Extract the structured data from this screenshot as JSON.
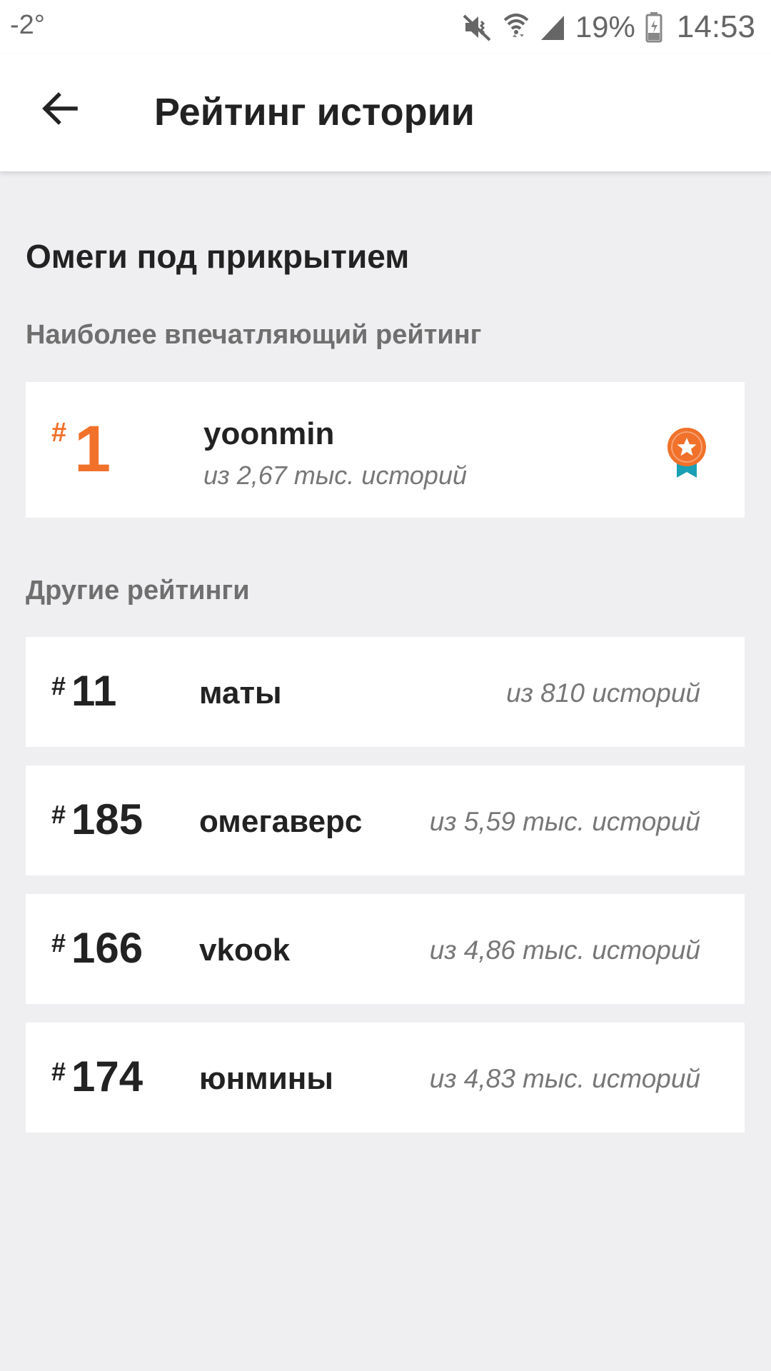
{
  "status_bar": {
    "temperature": "-2°",
    "battery": "19%",
    "time": "14:53"
  },
  "app_bar": {
    "title": "Рейтинг истории"
  },
  "story": {
    "title": "Омеги под прикрытием"
  },
  "top_ranking": {
    "label": "Наиболее впечатляющий рейтинг",
    "hash": "#",
    "rank": "1",
    "tag": "yoonmin",
    "subtitle": "из 2,67 тыс. историй"
  },
  "other_rankings": {
    "label": "Другие рейтинги",
    "items": [
      {
        "hash": "#",
        "rank": "11",
        "tag": "маты",
        "subtitle": "из 810 историй"
      },
      {
        "hash": "#",
        "rank": "185",
        "tag": "омегаверс",
        "subtitle": "из 5,59 тыс. историй"
      },
      {
        "hash": "#",
        "rank": "166",
        "tag": "vkook",
        "subtitle": "из 4,86 тыс. историй"
      },
      {
        "hash": "#",
        "rank": "174",
        "tag": "юнмины",
        "subtitle": "из 4,83 тыс. историй"
      }
    ]
  },
  "colors": {
    "accent": "#f1712a",
    "ribbon": "#1aa0b4",
    "background": "#efeef1",
    "card": "#ffffff"
  },
  "icons": {
    "back": "arrow-left-icon",
    "medal": "medal-icon",
    "mute": "mute-icon",
    "wifi": "wifi-icon",
    "signal": "signal-icon",
    "battery": "battery-icon"
  }
}
